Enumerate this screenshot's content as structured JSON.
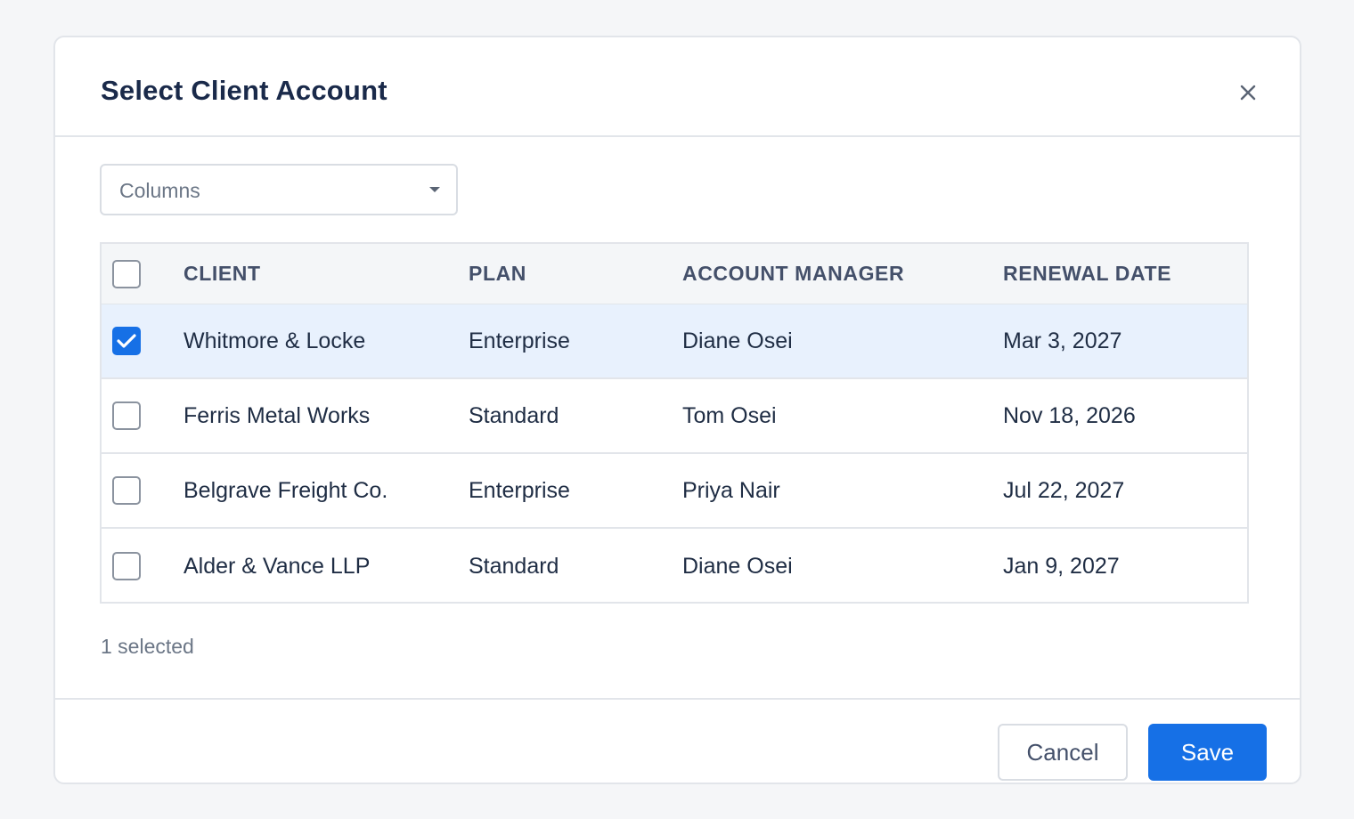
{
  "dialog": {
    "title": "Select Client Account",
    "close_icon": "close-icon"
  },
  "columns_select": {
    "label": "Columns",
    "icon": "caret-down-icon"
  },
  "table": {
    "headers": {
      "client": "CLIENT",
      "plan": "PLAN",
      "manager": "ACCOUNT MANAGER",
      "renewal": "RENEWAL DATE"
    },
    "select_all_checked": false,
    "rows": [
      {
        "client": "Whitmore & Locke",
        "plan": "Enterprise",
        "manager": "Diane Osei",
        "renewal": "Mar 3, 2027",
        "checked": true
      },
      {
        "client": "Ferris Metal Works",
        "plan": "Standard",
        "manager": "Tom Osei",
        "renewal": "Nov 18, 2026",
        "checked": false
      },
      {
        "client": "Belgrave Freight Co.",
        "plan": "Enterprise",
        "manager": "Priya Nair",
        "renewal": "Jul 22, 2027",
        "checked": false
      },
      {
        "client": "Alder & Vance LLP",
        "plan": "Standard",
        "manager": "Diane Osei",
        "renewal": "Jan 9, 2027",
        "checked": false
      }
    ]
  },
  "status": {
    "selected_text": "1 selected"
  },
  "footer": {
    "cancel_label": "Cancel",
    "save_label": "Save"
  },
  "colors": {
    "accent": "#1670e6",
    "selected_row_bg": "#e8f1fd",
    "header_bg": "#f4f6f8",
    "border": "#e2e5ea",
    "page_bg": "#f5f6f8"
  }
}
